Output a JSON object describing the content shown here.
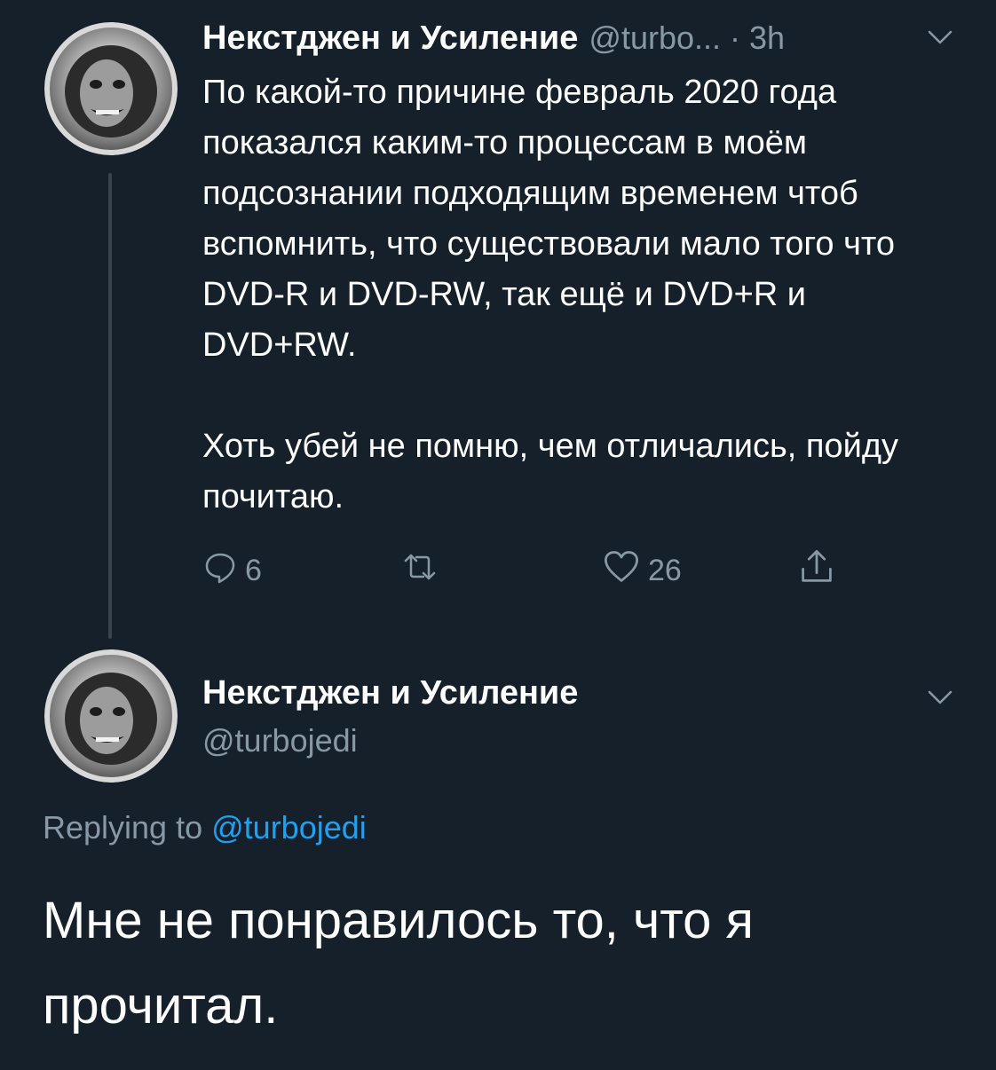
{
  "tweet1": {
    "author_name": "Некстджен и Усиление",
    "handle": "@turbo...",
    "separator": "·",
    "time": "3h",
    "paragraphs": [
      "По какой-то причине февраль 2020 года показался каким-то процессам в моём подсознании подходящим временем чтоб вспомнить, что существовали мало того что DVD-R и DVD-RW, так ещё и DVD+R и DVD+RW.",
      "Хоть убей не помню, чем отличались, пойду почитаю."
    ],
    "actions": {
      "reply_count": "6",
      "retweet_count": "",
      "like_count": "26"
    },
    "icons": {
      "reply": "reply-icon",
      "retweet": "retweet-icon",
      "like": "heart-icon",
      "share": "share-icon",
      "more": "chevron-down-icon"
    }
  },
  "tweet2": {
    "author_name": "Некстджен и Усиление",
    "handle": "@turbojedi",
    "replying_prefix": "Replying to",
    "replying_handle": "@turbojedi",
    "text": "Мне не понравилось то, что я прочитал."
  },
  "colors": {
    "background": "#15202b",
    "text": "#ffffff",
    "muted": "#8899a6",
    "link": "#1da1f2",
    "thread_line": "#38444d"
  }
}
